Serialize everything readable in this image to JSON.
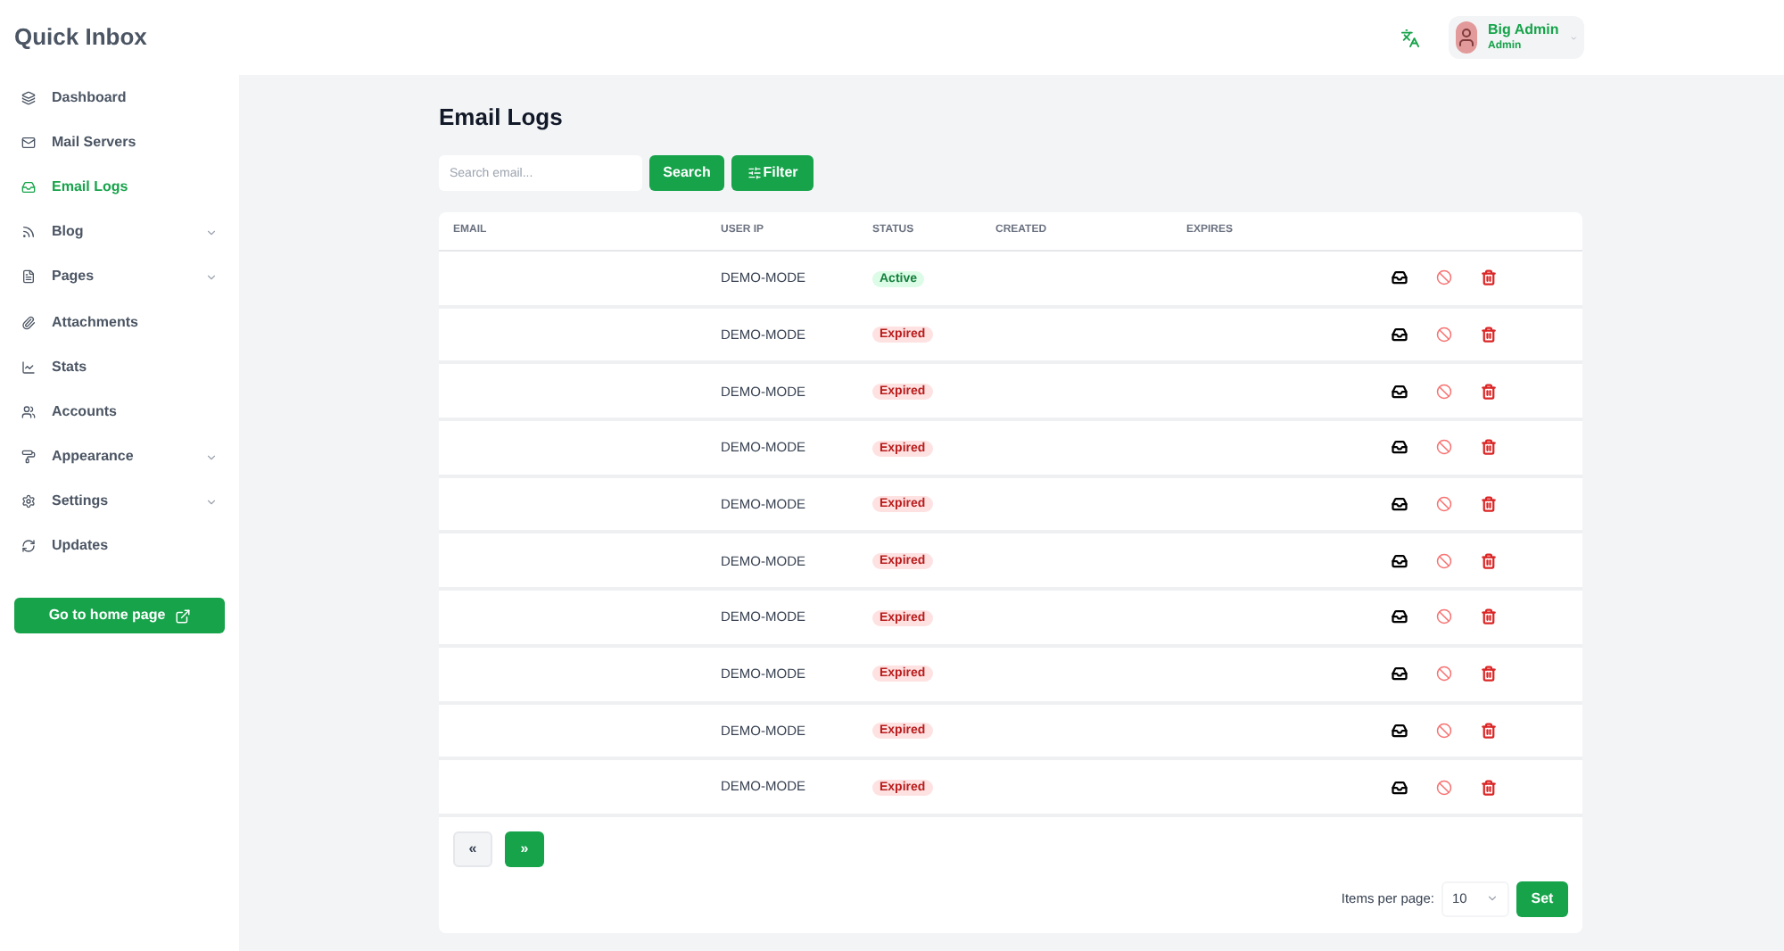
{
  "app_title": "Quick Inbox",
  "sidebar": {
    "items": [
      {
        "label": "Dashboard",
        "selected": false,
        "expandable": false
      },
      {
        "label": "Mail Servers",
        "selected": false,
        "expandable": false
      },
      {
        "label": "Email Logs",
        "selected": true,
        "expandable": false
      },
      {
        "label": "Blog",
        "selected": false,
        "expandable": true
      },
      {
        "label": "Pages",
        "selected": false,
        "expandable": true
      },
      {
        "label": "Attachments",
        "selected": false,
        "expandable": false
      },
      {
        "label": "Stats",
        "selected": false,
        "expandable": false
      },
      {
        "label": "Accounts",
        "selected": false,
        "expandable": false
      },
      {
        "label": "Appearance",
        "selected": false,
        "expandable": true
      },
      {
        "label": "Settings",
        "selected": false,
        "expandable": true
      },
      {
        "label": "Updates",
        "selected": false,
        "expandable": false
      }
    ],
    "home_button": "Go to home page"
  },
  "user": {
    "name": "Big Admin",
    "role": "Admin"
  },
  "page_title": "Email Logs",
  "search": {
    "placeholder": "Search email...",
    "button": "Search"
  },
  "filter_button": "Filter",
  "table": {
    "columns": [
      "EMAIL",
      "USER IP",
      "STATUS",
      "CREATED",
      "EXPIRES"
    ],
    "rows": [
      {
        "user_ip": "DEMO-MODE",
        "status": "Active",
        "kind": "active"
      },
      {
        "user_ip": "DEMO-MODE",
        "status": "Expired",
        "kind": "expired"
      },
      {
        "user_ip": "DEMO-MODE",
        "status": "Expired",
        "kind": "expired"
      },
      {
        "user_ip": "DEMO-MODE",
        "status": "Expired",
        "kind": "expired"
      },
      {
        "user_ip": "DEMO-MODE",
        "status": "Expired",
        "kind": "expired"
      },
      {
        "user_ip": "DEMO-MODE",
        "status": "Expired",
        "kind": "expired"
      },
      {
        "user_ip": "DEMO-MODE",
        "status": "Expired",
        "kind": "expired"
      },
      {
        "user_ip": "DEMO-MODE",
        "status": "Expired",
        "kind": "expired"
      },
      {
        "user_ip": "DEMO-MODE",
        "status": "Expired",
        "kind": "expired"
      },
      {
        "user_ip": "DEMO-MODE",
        "status": "Expired",
        "kind": "expired"
      }
    ]
  },
  "pagination": {
    "prev": {
      "label": "«",
      "disabled": true
    },
    "next": {
      "label": "»",
      "disabled": false
    }
  },
  "per_page": {
    "label": "Items per page:",
    "value": "10",
    "button": "Set"
  }
}
